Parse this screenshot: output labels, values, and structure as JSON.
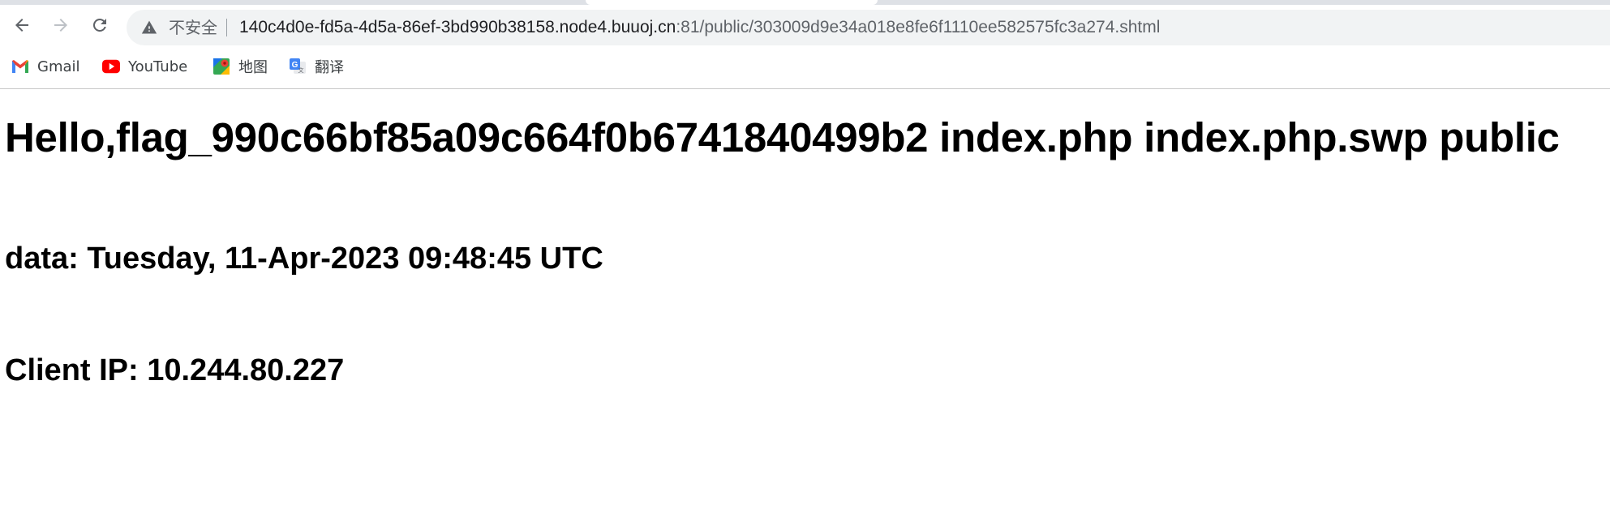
{
  "browser": {
    "security_label": "不安全",
    "url_host": "140c4d0e-fd5a-4d5a-86ef-3bd990b38158.node4.buuoj.cn",
    "url_rest": ":81/public/303009d9e34a018e8fe6f1110ee582575fc3a274.shtml",
    "icons": {
      "back": "back-arrow-icon",
      "forward": "forward-arrow-icon",
      "reload": "reload-icon",
      "warning": "warning-triangle-icon"
    }
  },
  "bookmarks": [
    {
      "label": "Gmail",
      "icon": "gmail-icon"
    },
    {
      "label": "YouTube",
      "icon": "youtube-icon"
    },
    {
      "label": "地图",
      "icon": "maps-icon"
    },
    {
      "label": "翻译",
      "icon": "translate-icon"
    }
  ],
  "page": {
    "heading": "Hello,flag_990c66bf85a09c664f0b6741840499b2 index.php index.php.swp public",
    "date_line": "data: Tuesday, 11-Apr-2023 09:48:45 UTC",
    "ip_line": "Client IP: 10.244.80.227"
  },
  "colors": {
    "omnibox_bg": "#f1f3f4",
    "text_primary": "#202124",
    "text_secondary": "#5f6368",
    "youtube_red": "#ff0000",
    "gmail_red": "#ea4335"
  }
}
